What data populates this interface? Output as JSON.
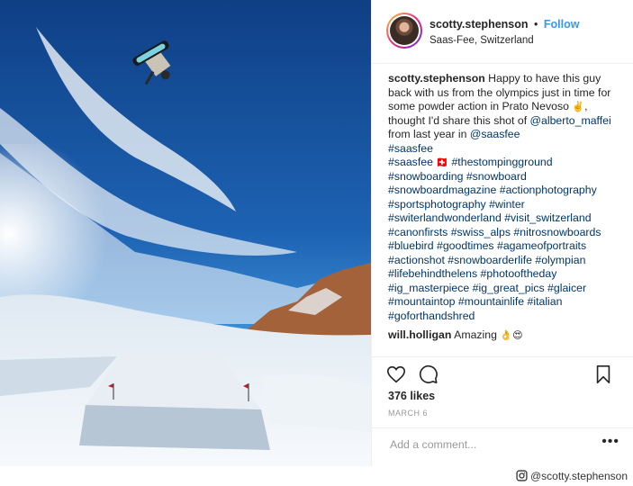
{
  "post": {
    "username": "scotty.stephenson",
    "separator": "•",
    "follow_label": "Follow",
    "location": "Saas-Fee, Switzerland"
  },
  "caption": {
    "username": "scotty.stephenson",
    "text_1": "Happy to have this guy back with us from the olympics just in time for some powder action in Prato Nevoso",
    "emoji_1": "✌️",
    "text_2": ", thought I'd share this shot of",
    "mention_1": "@alberto_maffei",
    "text_3": "from last year in",
    "mention_2": "@saasfee",
    "tag_1": "#saasfee",
    "tag_2": "#saasfee",
    "emoji_flag": "🇨🇭",
    "hashtags": "#thestompingground #snowboarding #snowboard #snowboardmagazine #actionphotography #sportsphotography #winter #switerlandwonderland #visit_switzerland #canonfirsts #swiss_alps #nitrosnowboards #bluebird #goodtimes #agameofportraits #actionshot #snowboarderlife #olympian #lifebehindthelens #photooftheday #ig_masterpiece #ig_great_pics #glaicer #mountaintop #mountainlife #italian #goforthandshred"
  },
  "reply": {
    "username": "will.holligan",
    "text": "Amazing",
    "emoji": "👌😍"
  },
  "actions": {
    "icons": [
      "heart-icon",
      "comment-icon",
      "bookmark-icon"
    ],
    "likes": "376 likes",
    "date": "MARCH 6",
    "comment_placeholder": "Add a comment...",
    "more_label": "•••"
  },
  "credit": {
    "icon": "instagram-icon",
    "handle": "@scotty.stephenson"
  },
  "colors": {
    "link": "#003569",
    "follow": "#3897f0",
    "text": "#262626",
    "sky": "#1f5faa"
  }
}
